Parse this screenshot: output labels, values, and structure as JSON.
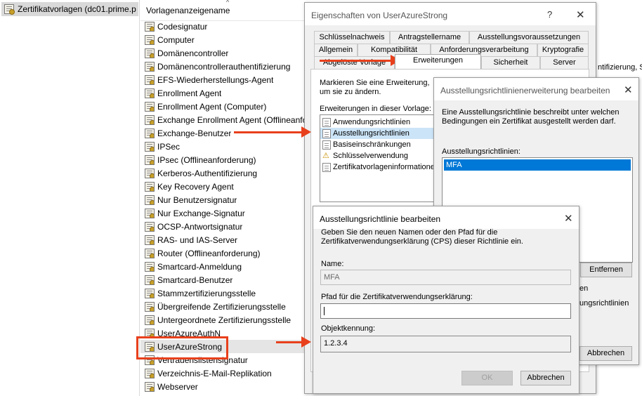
{
  "tree": {
    "root_label": "Zertifikatvorlagen (dc01.prime.p"
  },
  "list": {
    "column_header": "Vorlagenanzeigename",
    "items": [
      "Codesignatur",
      "Computer",
      "Domänencontroller",
      "Domänencontrollerauthentifizierung",
      "EFS-Wiederherstellungs-Agent",
      "Enrollment Agent",
      "Enrollment Agent (Computer)",
      "Exchange Enrollment Agent (Offlineanfo",
      "Exchange-Benutzer",
      "IPSec",
      "IPsec (Offlineanforderung)",
      "Kerberos-Authentifizierung",
      "Key Recovery Agent",
      "Nur Benutzersignatur",
      "Nur Exchange-Signatur",
      "OCSP-Antwortsignatur",
      "RAS- und IAS-Server",
      "Router (Offlineanforderung)",
      "Smartcard-Anmeldung",
      "Smartcard-Benutzer",
      "Stammzertifizierungsstelle",
      "Übergreifende Zertifizierungsstelle",
      "Untergeordnete Zertifizierungsstelle",
      "UserAzureAuthN",
      "UserAzureStrong",
      "Vertrauenslistensignatur",
      "Verzeichnis-E-Mail-Replikation",
      "Webserver"
    ],
    "selected_index": 24
  },
  "props": {
    "title": "Eigenschaften von UserAzureStrong",
    "help": "?",
    "close": "✕",
    "tabs_row1": [
      "Schlüsselnachweis",
      "Antragstellername",
      "Ausstellungsvoraussetzungen"
    ],
    "tabs_row2": [
      "Allgemein",
      "Kompatibilität",
      "Anforderungsverarbeitung",
      "Kryptografie"
    ],
    "tabs_row3": [
      "Abgelöste Vorlage",
      "Erweiterungen",
      "Sicherheit",
      "Server"
    ],
    "instruction": "Markieren Sie eine Erweiterung, um sie zu ändern.",
    "ext_label": "Erweiterungen in dieser Vorlage:",
    "extensions": [
      "Anwendungsrichtlinien",
      "Ausstellungsrichtlinien",
      "Basiseinschränkungen",
      "Schlüsselverwendung",
      "Zertifikatvorlageninformationen"
    ],
    "right_clip": "ntifizierung, S"
  },
  "ext_dialog": {
    "title": "Ausstellungsrichtlinienerweiterung bearbeiten",
    "close": "✕",
    "desc": "Eine Ausstellungsrichtlinie beschreibt unter welchen Bedingungen ein Zertifikat ausgestellt werden darf.",
    "list_label": "Ausstellungsrichtlinien:",
    "policies": [
      "MFA"
    ],
    "remove_button": "Entfernen",
    "clip1": "en",
    "clip2": "ungsrichtlinien",
    "cancel_button": "Abbrechen"
  },
  "edit_dialog": {
    "title": "Ausstellungsrichtlinie bearbeiten",
    "close": "✕",
    "desc": "Geben Sie den neuen Namen oder den Pfad für die Zertifikatverwendungserklärung (CPS) dieser Richtlinie ein.",
    "name_label": "Name:",
    "name_value": "MFA",
    "cps_label": "Pfad für die Zertifikatverwendungserklärung:",
    "cps_value": "",
    "oid_label": "Objektkennung:",
    "oid_value": "1.2.3.4",
    "ok_button": "OK",
    "cancel_button": "Abbrechen"
  },
  "colors": {
    "annotation": "#e8401c",
    "selection": "#cce4f7",
    "list_selection": "#0078d7"
  }
}
